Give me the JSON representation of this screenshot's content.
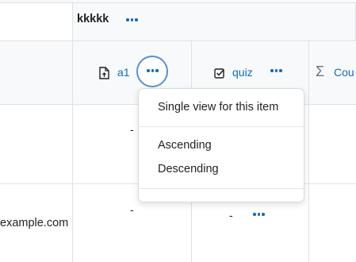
{
  "table": {
    "group_header": {
      "label": "kkkkk"
    },
    "columns": [
      {
        "label": "a1",
        "icon": "assignment-upload-icon"
      },
      {
        "label": "quiz",
        "icon": "quiz-checkbox-icon"
      },
      {
        "label": "Cou",
        "icon": "sigma-icon"
      }
    ],
    "rows": [
      {
        "cells": [
          "-"
        ]
      },
      {
        "email": "example.com",
        "cells": [
          "-",
          "-"
        ]
      }
    ]
  },
  "menu": {
    "single_view": "Single view for this item",
    "ascending": "Ascending",
    "descending": "Descending"
  },
  "colors": {
    "accent": "#0f6cbf",
    "border": "#dee2e6",
    "header_bg": "#f8f9fa"
  }
}
